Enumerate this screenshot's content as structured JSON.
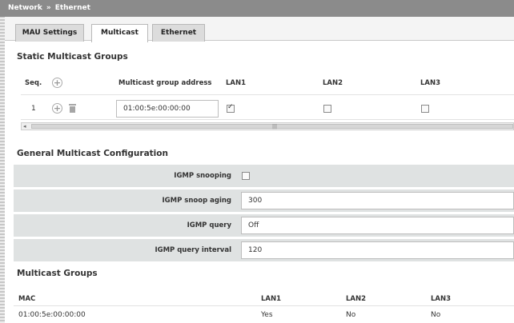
{
  "breadcrumb": {
    "parent": "Network",
    "separator": "»",
    "current": "Ethernet"
  },
  "tabs": [
    {
      "label": "MAU Settings"
    },
    {
      "label": "Multicast"
    },
    {
      "label": "Ethernet"
    }
  ],
  "static_groups": {
    "title": "Static Multicast Groups",
    "headers": {
      "seq": "Seq.",
      "address": "Multicast group address",
      "lan1": "LAN1",
      "lan2": "LAN2",
      "lan3": "LAN3"
    },
    "rows": [
      {
        "seq": "1",
        "address": "01:00:5e:00:00:00",
        "lan1": true,
        "lan2": false,
        "lan3": false
      }
    ],
    "scroll_grip": "|||"
  },
  "general_config": {
    "title": "General Multicast Configuration",
    "igmp_snooping": {
      "label": "IGMP snooping",
      "checked": false
    },
    "igmp_snoop_aging": {
      "label": "IGMP snoop aging",
      "value": "300"
    },
    "igmp_query": {
      "label": "IGMP query",
      "value": "Off"
    },
    "igmp_query_interval": {
      "label": "IGMP query interval",
      "value": "120"
    }
  },
  "multicast_groups": {
    "title": "Multicast Groups",
    "headers": {
      "mac": "MAC",
      "lan1": "LAN1",
      "lan2": "LAN2",
      "lan3": "LAN3"
    },
    "rows": [
      {
        "mac": "01:00:5e:00:00:00",
        "lan1": "Yes",
        "lan2": "No",
        "lan3": "No"
      }
    ]
  }
}
